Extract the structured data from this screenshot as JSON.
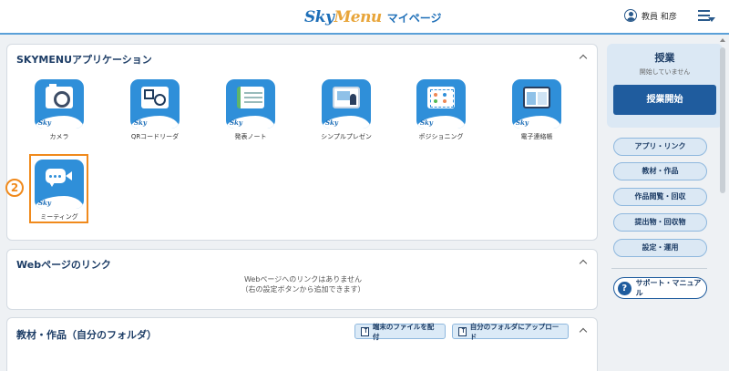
{
  "header": {
    "logo_sky": "Sky",
    "logo_menu": "Menu",
    "page_title": "マイページ",
    "user_name": "教員 和彦"
  },
  "apps_panel": {
    "title": "SKYMENUアプリケーション",
    "apps": [
      {
        "label": "カメラ",
        "icon": "camera-icon"
      },
      {
        "label": "QRコードリーダ",
        "icon": "qr-reader-icon"
      },
      {
        "label": "発表ノート",
        "icon": "note-icon"
      },
      {
        "label": "シンプルプレゼン",
        "icon": "presentation-icon"
      },
      {
        "label": "ポジショニング",
        "icon": "positioning-icon"
      },
      {
        "label": "電子連絡帳",
        "icon": "board-icon"
      },
      {
        "label": "ミーティング",
        "icon": "meeting-icon"
      }
    ],
    "step_number": "2"
  },
  "web_panel": {
    "title": "Webページのリンク",
    "empty_line1": "Webページへのリンクはありません",
    "empty_line2": "（右の設定ボタンから追加できます）"
  },
  "materials_panel": {
    "title": "教材・作品（自分のフォルダ）",
    "distribute_label": "端末のファイルを配付",
    "upload_label": "自分のフォルダにアップロード"
  },
  "sidebar": {
    "class_title": "授業",
    "class_status": "開始していません",
    "start_label": "授業開始",
    "buttons": [
      "アプリ・リンク",
      "教材・作品",
      "作品閲覧・回収",
      "提出物・回収物",
      "設定・運用"
    ],
    "support_label": "サポート・マニュアル"
  }
}
